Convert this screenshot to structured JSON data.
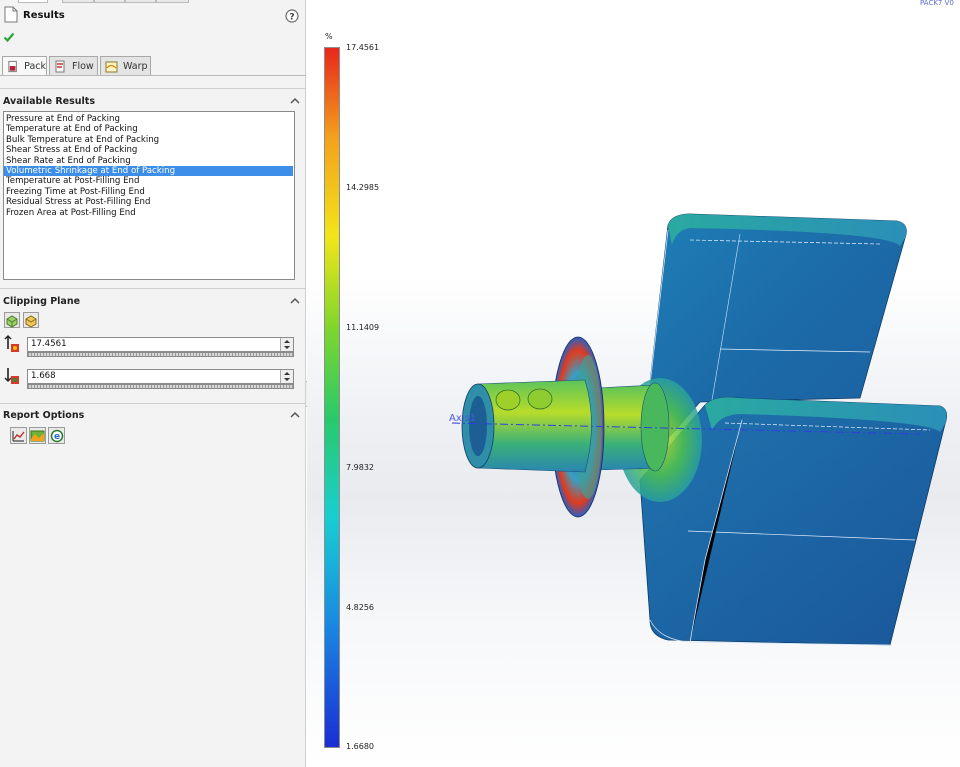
{
  "panel": {
    "title": "Results",
    "help_icon": "help-icon",
    "status_icon": "checkmark-icon",
    "tabs": [
      {
        "label": "Pack",
        "icon": "pack-icon",
        "active": true
      },
      {
        "label": "Flow",
        "icon": "flow-icon",
        "active": false
      },
      {
        "label": "Warp",
        "icon": "warp-icon",
        "active": false
      }
    ],
    "available_results": {
      "title": "Available Results",
      "items": [
        "Pressure at End of Packing",
        "Temperature at End of Packing",
        "Bulk Temperature at End of Packing",
        "Shear Stress at End of Packing",
        "Shear Rate at End of Packing",
        "Volumetric Shrinkage at End of Packing",
        "Temperature at Post-Filling End",
        "Freezing Time at Post-Filling End",
        "Residual Stress at Post-Filling End",
        "Frozen Area at Post-Filling End"
      ],
      "selected_index": 5
    },
    "clipping_plane": {
      "title": "Clipping Plane",
      "upper_value": "17.4561",
      "lower_value": "1.668"
    },
    "report_options": {
      "title": "Report Options"
    }
  },
  "viewport": {
    "unit": "%",
    "corner_label": "PACK7 V0",
    "axis_label": "Axis1",
    "legend_ticks": [
      "17.4561",
      "14.2985",
      "11.1409",
      "7.9832",
      "4.8256",
      "1.6680"
    ],
    "legend_max": 17.4561,
    "legend_min": 1.668,
    "colors": {
      "high": "#e8271b",
      "mid": "#29c96a",
      "low": "#1a2ed4",
      "selection": "#3d8ee8",
      "part_body": "#1f78b0"
    }
  }
}
